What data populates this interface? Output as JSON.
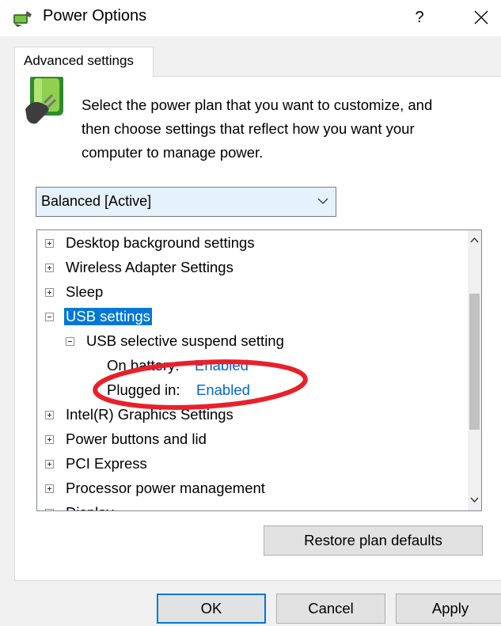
{
  "window": {
    "title": "Power Options",
    "help_label": "?",
    "close_label": "×"
  },
  "tab": {
    "label": "Advanced settings"
  },
  "intro": {
    "text": "Select the power plan that you want to customize, and then choose settings that reflect how you want your computer to manage power."
  },
  "plan": {
    "selected": "Balanced [Active]"
  },
  "tree": {
    "items": [
      {
        "label": "Desktop background settings",
        "state": "collapsed"
      },
      {
        "label": "Wireless Adapter Settings",
        "state": "collapsed"
      },
      {
        "label": "Sleep",
        "state": "collapsed"
      },
      {
        "label": "USB settings",
        "state": "expanded",
        "selected": true
      },
      {
        "label": "USB selective suspend setting",
        "state": "expanded"
      },
      {
        "label": "On battery:",
        "value": "Enabled"
      },
      {
        "label": "Plugged in:",
        "value": "Enabled"
      },
      {
        "label": "Intel(R) Graphics Settings",
        "state": "collapsed"
      },
      {
        "label": "Power buttons and lid",
        "state": "collapsed"
      },
      {
        "label": "PCI Express",
        "state": "collapsed"
      },
      {
        "label": "Processor power management",
        "state": "collapsed"
      },
      {
        "label": "Display",
        "state": "collapsed"
      }
    ],
    "scrollbar_position": 0.42
  },
  "buttons": {
    "restore_label": "Restore plan defaults",
    "ok_label": "OK",
    "cancel_label": "Cancel",
    "apply_label": "Apply"
  },
  "colors": {
    "selection": "#0078d7",
    "link_value": "#0066cc",
    "annotation": "#e8202a"
  }
}
